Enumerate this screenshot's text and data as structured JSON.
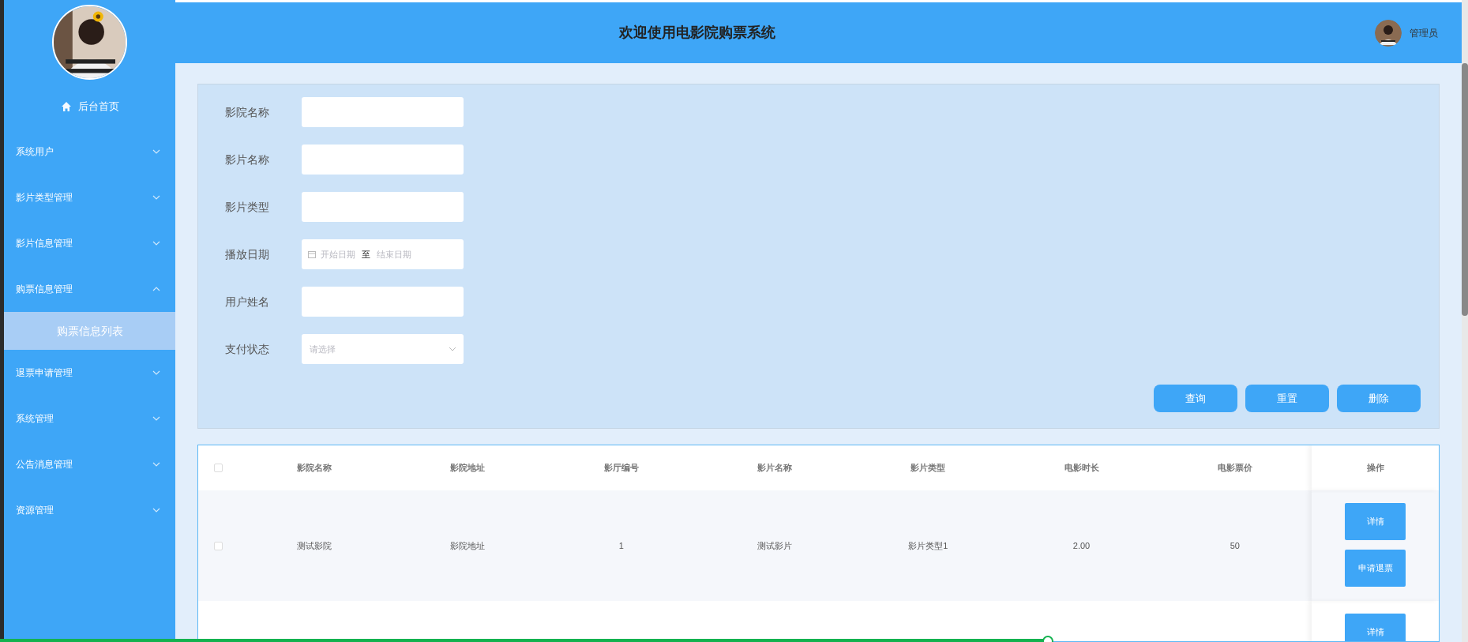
{
  "sidebar": {
    "items": [
      {
        "kind": "home",
        "label": "后台首页"
      },
      {
        "kind": "menu",
        "label": "系统用户",
        "expanded": false
      },
      {
        "kind": "menu",
        "label": "影片类型管理",
        "expanded": false
      },
      {
        "kind": "menu",
        "label": "影片信息管理",
        "expanded": false
      },
      {
        "kind": "menu",
        "label": "购票信息管理",
        "expanded": true,
        "children": [
          {
            "label": "购票信息列表",
            "selected": true
          }
        ]
      },
      {
        "kind": "menu",
        "label": "退票申请管理",
        "expanded": false
      },
      {
        "kind": "menu",
        "label": "系统管理",
        "expanded": false
      },
      {
        "kind": "menu",
        "label": "公告消息管理",
        "expanded": false
      },
      {
        "kind": "menu",
        "label": "资源管理",
        "expanded": false
      }
    ]
  },
  "header": {
    "title": "欢迎使用电影院购票系统",
    "user": "管理员"
  },
  "filters": [
    {
      "kind": "text",
      "label": "影院名称"
    },
    {
      "kind": "text",
      "label": "影片名称"
    },
    {
      "kind": "text",
      "label": "影片类型"
    },
    {
      "kind": "daterange",
      "label": "播放日期",
      "start_placeholder": "开始日期",
      "separator": "至",
      "end_placeholder": "结束日期"
    },
    {
      "kind": "text",
      "label": "用户姓名"
    },
    {
      "kind": "select",
      "label": "支付状态",
      "placeholder": "请选择"
    }
  ],
  "actions": [
    "查询",
    "重置",
    "删除"
  ],
  "table": {
    "select_all_checked": false,
    "columns": [
      "影院名称",
      "影院地址",
      "影厅编号",
      "影片名称",
      "影片类型",
      "电影时长",
      "电影票价",
      "操作"
    ],
    "rows": [
      {
        "checked": false,
        "cells": [
          "测试影院",
          "影院地址",
          "1",
          "测试影片",
          "影片类型1",
          "2.00",
          "50"
        ],
        "actions": [
          "详情",
          "申请退票"
        ]
      },
      {
        "cells": [],
        "actions": [
          "详情"
        ]
      }
    ]
  },
  "playback": {
    "level": 0.714
  }
}
